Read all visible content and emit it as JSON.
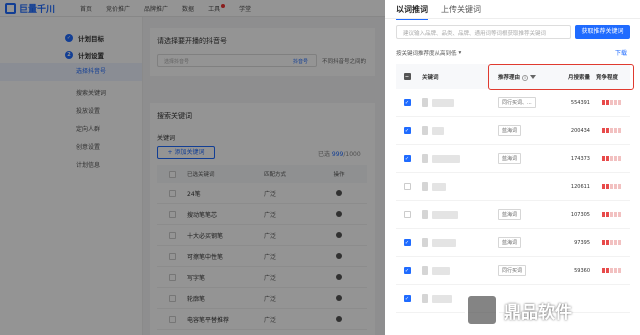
{
  "topbar": {
    "brand": "巨量千川",
    "nav": [
      "首页",
      "竞价推广",
      "品牌推广",
      "数据",
      "工具",
      "学堂"
    ]
  },
  "sidebar": {
    "steps": [
      {
        "label": "计划目标",
        "icon": "check-icon"
      },
      {
        "label": "计划设置",
        "icon": "step-number-icon",
        "number": "2"
      }
    ],
    "items": [
      "选择抖音号",
      "搜索关键词",
      "投放设置",
      "定向人群",
      "创意设置",
      "计划信息"
    ],
    "active_index": 0
  },
  "main": {
    "card1": {
      "title": "请选择要开播的抖音号",
      "account_placeholder": "选择抖音号",
      "account_tag": "抖音号",
      "hint": "不同抖音号之间的"
    },
    "card2": {
      "title": "搜索关键词",
      "kw_label": "关键词",
      "add_button": "+ 添加关键词",
      "counter_prefix": "已选 ",
      "counter_count": "999",
      "counter_suffix": "/1000",
      "columns": [
        "已选关键词",
        "匹配方式",
        "操作"
      ],
      "rows": [
        {
          "keyword": "24笔",
          "match": "广泛"
        },
        {
          "keyword": "搜动笔笔芯",
          "match": "广泛"
        },
        {
          "keyword": "十大必买钢笔",
          "match": "广泛"
        },
        {
          "keyword": "可擦笔中性笔",
          "match": "广泛"
        },
        {
          "keyword": "写字笔",
          "match": "广泛"
        },
        {
          "keyword": "轮廓笔",
          "match": "广泛"
        },
        {
          "keyword": "电容笔平替推荐",
          "match": "广泛"
        }
      ]
    }
  },
  "drawer": {
    "tabs": [
      "以词推词",
      "上传关键词"
    ],
    "active_tab": 0,
    "search_placeholder": "建议输入品牌、品类、品牌、通用词等词根获取推荐关键词",
    "fetch_button": "获取推荐关键词",
    "sort_label": "按关键词推荐度从高到低",
    "download": "下载",
    "columns": {
      "keyword": "关键词",
      "reason": "推荐理由",
      "volume": "月搜索量",
      "competition": "竞争程度"
    },
    "rows": [
      {
        "checked": true,
        "reason": "同行买词、...",
        "volume": "554391",
        "level": 2
      },
      {
        "checked": true,
        "reason": "蓝海词",
        "volume": "200434",
        "level": 2
      },
      {
        "checked": true,
        "reason": "蓝海词",
        "volume": "174373",
        "level": 2
      },
      {
        "checked": false,
        "reason": "",
        "volume": "120611",
        "level": 2
      },
      {
        "checked": false,
        "reason": "蓝海词",
        "volume": "107305",
        "level": 2
      },
      {
        "checked": true,
        "reason": "蓝海词",
        "volume": "97395",
        "level": 2
      },
      {
        "checked": true,
        "reason": "同行买词",
        "volume": "59360",
        "level": 2
      },
      {
        "checked": true,
        "reason": "",
        "volume": "",
        "level": 0
      }
    ]
  },
  "watermark": {
    "text": "鼎品软件"
  },
  "colors": {
    "accent": "#1f6bff",
    "highlight_box": "#e03a2f",
    "competition_hot": "#e84a4a"
  }
}
